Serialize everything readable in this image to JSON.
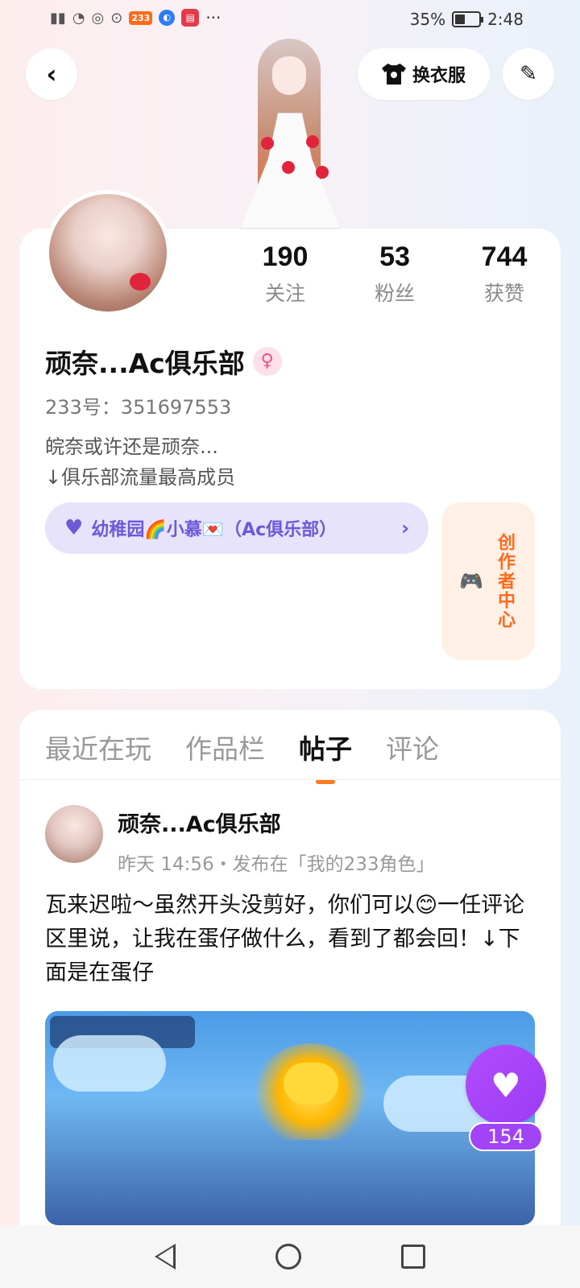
{
  "status_bar": {
    "battery_percent": "35%",
    "time": "2:48",
    "badge_233": "233",
    "more": "···"
  },
  "header": {
    "back_icon": "chevron-left-icon",
    "dress_up_label": "换衣服",
    "edit_icon": "pencil-icon"
  },
  "profile": {
    "stats": [
      {
        "value": "190",
        "label": "关注"
      },
      {
        "value": "53",
        "label": "粉丝"
      },
      {
        "value": "744",
        "label": "获赞"
      }
    ],
    "username": "顽奈...Ac俱乐部",
    "gender_symbol": "♀",
    "uid": "233号：351697553",
    "bio_line1": "皖奈或许还是顽奈...",
    "bio_line2": "↓俱乐部流量最高成员",
    "club_label": "幼稚园🌈小慕💌（Ac俱乐部）",
    "club_arrow": "›",
    "creator_center": "创作者中心"
  },
  "tabs": [
    {
      "label": "最近在玩",
      "active": false
    },
    {
      "label": "作品栏",
      "active": false
    },
    {
      "label": "帖子",
      "active": true
    },
    {
      "label": "评论",
      "active": false
    }
  ],
  "post": {
    "author": "顽奈...Ac俱乐部",
    "meta": "昨天 14:56・发布在「我的233角色」",
    "text": "瓦来迟啦～虽然开头没剪好，你们可以😊一任评论区里说，让我在蛋仔做什么，看到了都会回！↓下面是在蛋仔"
  },
  "like": {
    "icon": "heart-icon",
    "count": "154"
  },
  "colors": {
    "accent_orange": "#ff7a1f",
    "like_purple": "#a143f7",
    "club_purple": "#6b59d8"
  }
}
